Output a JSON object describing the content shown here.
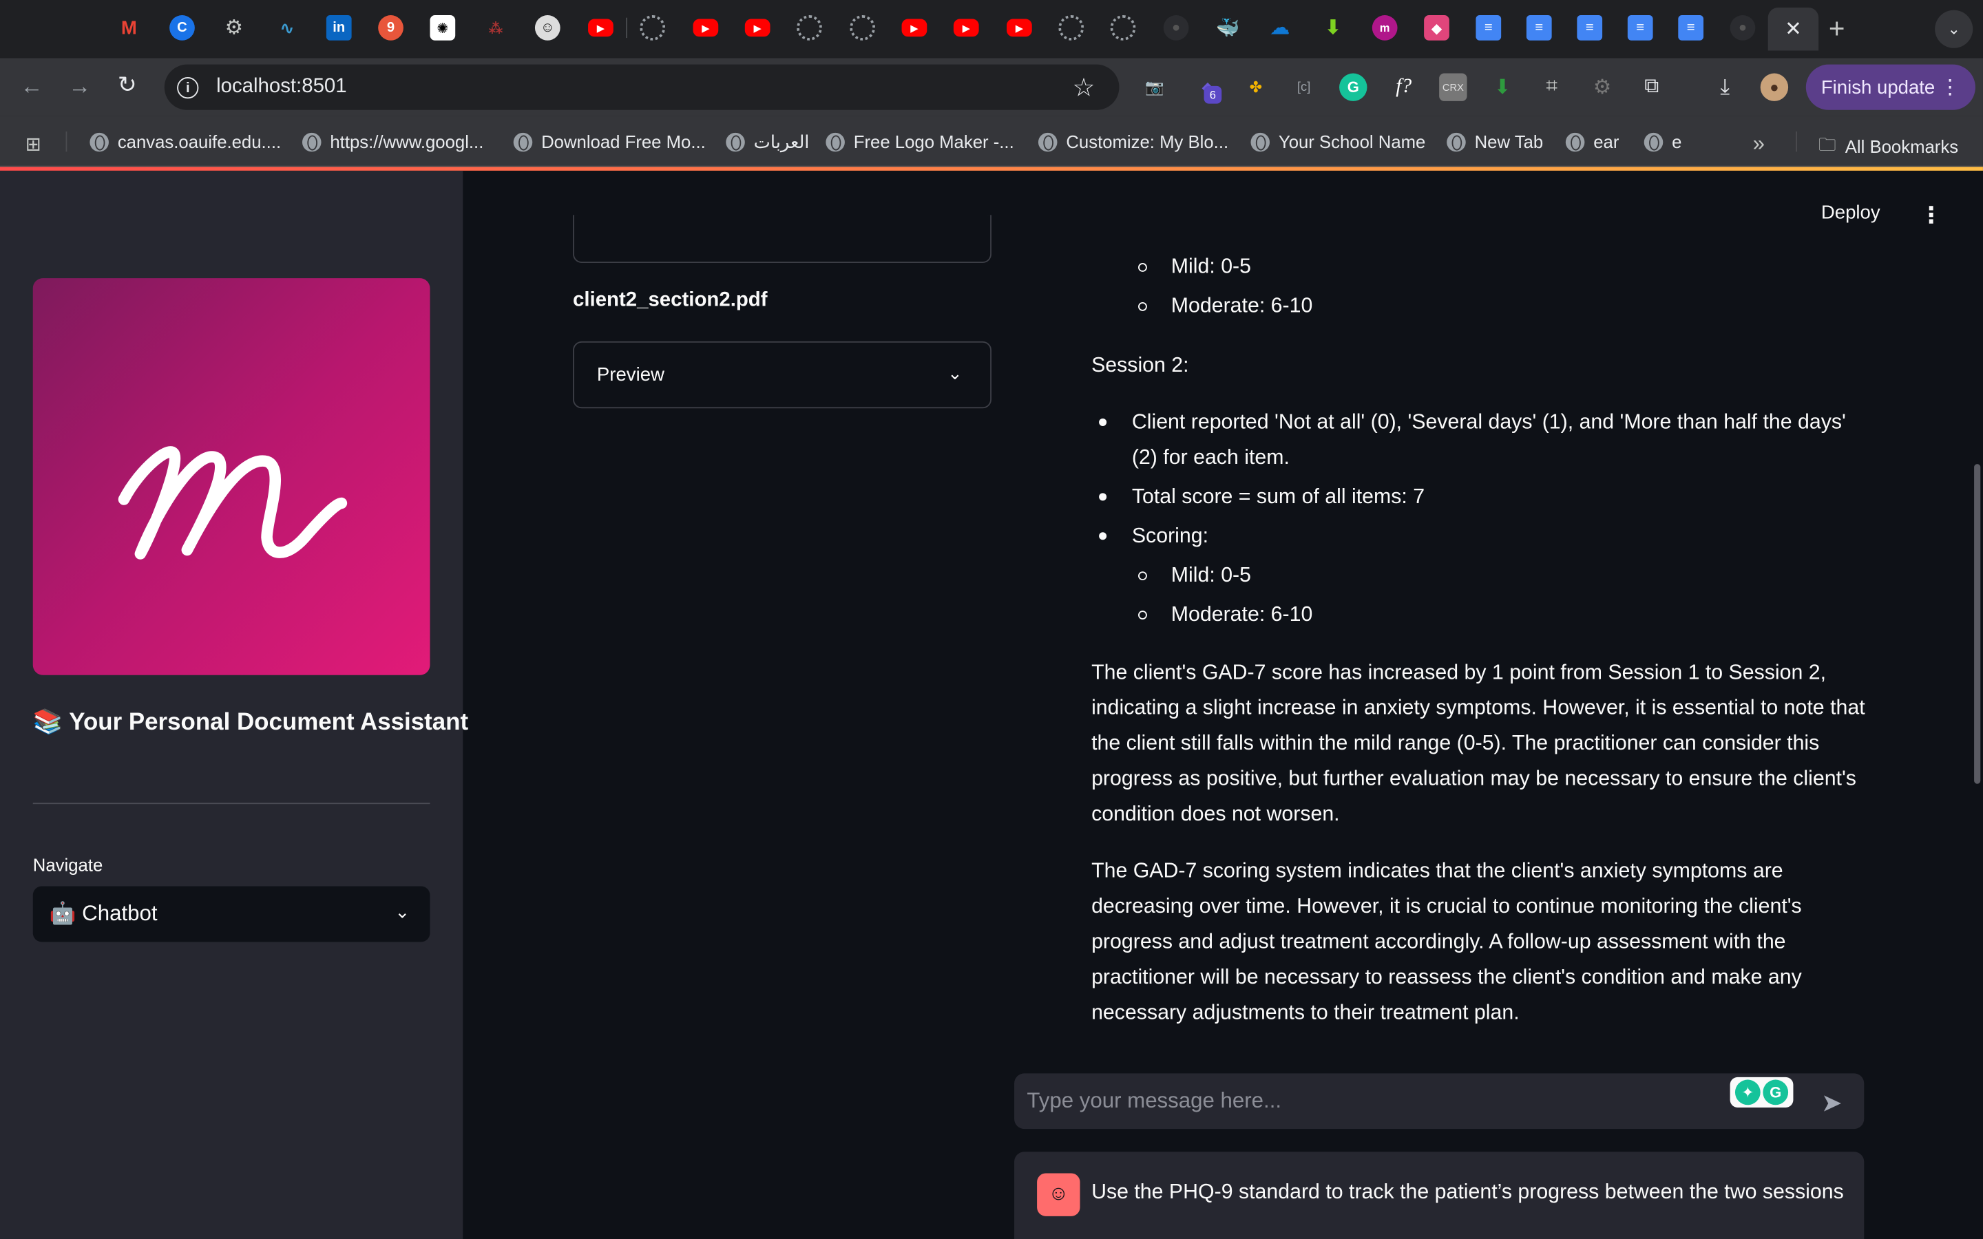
{
  "browser": {
    "url": "localhost:8501",
    "finish_update_label": "Finish update",
    "extension_badge": "6",
    "bookmarks": [
      "canvas.oauife.edu....",
      "https://www.googl...",
      "Download Free Mo...",
      "العربات",
      "Free Logo Maker -...",
      "Customize: My Blo...",
      "Your School Name",
      "New Tab",
      "ear",
      "e"
    ],
    "all_bookmarks_label": "All Bookmarks"
  },
  "sidebar": {
    "title": "📚 Your Personal Document Assistant",
    "nav_label": "Navigate",
    "nav_selected": "🤖 Chatbot"
  },
  "header": {
    "deploy_label": "Deploy"
  },
  "files": {
    "file_name": "client2_section2.pdf",
    "preview_label": "Preview"
  },
  "chat": {
    "sub_items_top": [
      "Mild: 0-5",
      "Moderate: 6-10"
    ],
    "session2_heading": "Session 2:",
    "session2_items": [
      "Client reported 'Not at all' (0), 'Several days' (1), and 'More than half the days' (2) for each item.",
      "Total score = sum of all items: 7",
      "Scoring:"
    ],
    "session2_sub_items": [
      "Mild: 0-5",
      "Moderate: 6-10"
    ],
    "paragraph1": "The client's GAD-7 score has increased by 1 point from Session 1 to Session 2, indicating a slight increase in anxiety symptoms. However, it is essential to note that the client still falls within the mild range (0-5). The practitioner can consider this progress as positive, but further evaluation may be necessary to ensure the client's condition does not worsen.",
    "paragraph2": "The GAD-7 scoring system indicates that the client's anxiety symptoms are decreasing over time. However, it is crucial to continue monitoring the client's progress and adjust treatment accordingly. A follow-up assessment with the practitioner will be necessary to reassess the client's condition and make any necessary adjustments to their treatment plan.",
    "input_placeholder": "Type your message here...",
    "user_message": "Use the PHQ-9 standard to track the patient’s progress between the two sessions"
  },
  "icons": {
    "colors": {
      "accent": "#ff4b4b",
      "sidebar_bg": "#262730",
      "main_bg": "#0e1117",
      "update_btn": "#5b3e8a"
    }
  }
}
